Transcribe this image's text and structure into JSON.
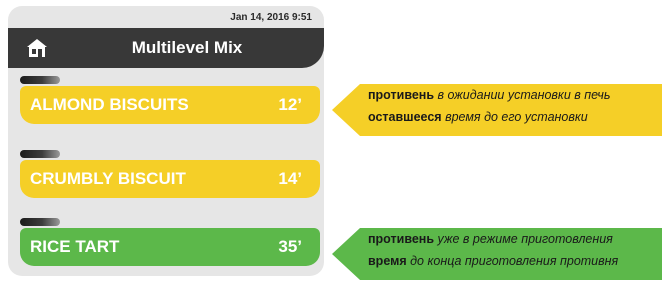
{
  "status": {
    "datetime": "Jan 14, 2016  9:51"
  },
  "header": {
    "title": "Multilevel Mix",
    "home_icon": "home-icon"
  },
  "trays": [
    {
      "name": "ALMOND BISCUITS",
      "time": "12’",
      "state": "waiting",
      "color": "#f5cf27"
    },
    {
      "name": "CRUMBLY BISCUIT",
      "time": "14’",
      "state": "waiting",
      "color": "#f5cf27"
    },
    {
      "name": "RICE TART",
      "time": "35’",
      "state": "cooking",
      "color": "#5cb84a"
    }
  ],
  "callouts": [
    {
      "color": "#f5cf27",
      "line1_bold": "противень",
      "line1_rest": " в ожидании установки в печь",
      "line2_bold": "оставшееся",
      "line2_rest": " время до его установки"
    },
    {
      "color": "#5cb84a",
      "line1_bold": "противень",
      "line1_rest": " уже в режиме приготовления",
      "line2_bold": "время",
      "line2_rest": " до конца приготовления противня"
    }
  ]
}
